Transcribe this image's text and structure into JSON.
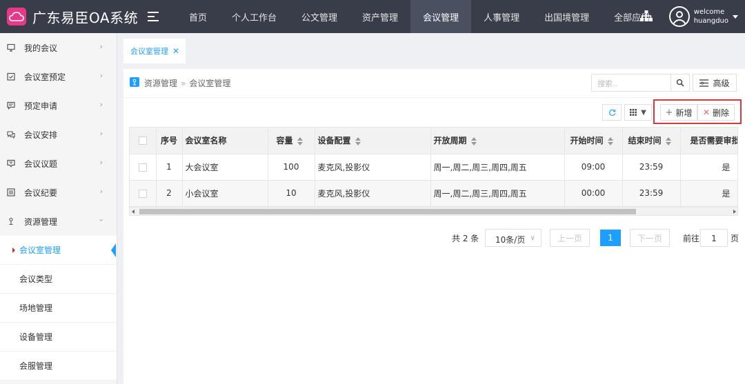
{
  "header": {
    "logo_text": "LOGO",
    "title": "广东易臣OA系统",
    "nav": [
      {
        "label": "首页"
      },
      {
        "label": "个人工作台"
      },
      {
        "label": "公文管理"
      },
      {
        "label": "资产管理"
      },
      {
        "label": "会议管理",
        "active": true
      },
      {
        "label": "人事管理"
      },
      {
        "label": "出国境管理"
      },
      {
        "label": "全部应用"
      }
    ],
    "user": {
      "greeting": "welcome",
      "name": "huangduo"
    }
  },
  "sidebar": {
    "items": [
      {
        "label": "我的会议",
        "icon": "monitor-icon"
      },
      {
        "label": "会议室预定",
        "icon": "calendar-check-icon"
      },
      {
        "label": "预定申请",
        "icon": "message-icon"
      },
      {
        "label": "会议安排",
        "icon": "chat-icon"
      },
      {
        "label": "会议议题",
        "icon": "topic-icon"
      },
      {
        "label": "会议纪要",
        "icon": "list-icon"
      },
      {
        "label": "资源管理",
        "icon": "pin-icon",
        "expanded": true
      }
    ],
    "subitems": [
      {
        "label": "会议室管理",
        "active": true
      },
      {
        "label": "会议类型"
      },
      {
        "label": "场地管理"
      },
      {
        "label": "设备管理"
      },
      {
        "label": "会服管理"
      }
    ]
  },
  "tabs": [
    {
      "label": "会议室管理",
      "close": "✕"
    }
  ],
  "breadcrumb": {
    "parent": "资源管理",
    "separator": "»",
    "current": "会议室管理"
  },
  "search": {
    "placeholder": "搜索..",
    "advanced_label": "高级"
  },
  "toolbar": {
    "add_label": "新增",
    "delete_label": "删除"
  },
  "table": {
    "columns": [
      "序号",
      "会议室名称",
      "容量",
      "设备配置",
      "开放周期",
      "开始时间",
      "结束时间",
      "是否需要审批"
    ],
    "rows": [
      {
        "no": "1",
        "name": "大会议室",
        "capacity": "100",
        "equipment": "麦克风,投影仪",
        "period": "周一,周二,周三,周四,周五",
        "start": "09:00",
        "end": "23:59",
        "approval": "是"
      },
      {
        "no": "2",
        "name": "小会议室",
        "capacity": "10",
        "equipment": "麦克风,投影仪",
        "period": "周一,周二,周三,周四,周五",
        "start": "00:00",
        "end": "23:59",
        "approval": "是"
      }
    ]
  },
  "pagination": {
    "total_text": "共 2 条",
    "page_size": "10条/页",
    "prev_label": "上一页",
    "current_page": "1",
    "next_label": "下一页",
    "goto_label": "前往",
    "goto_value": "1",
    "page_unit": "页"
  },
  "colors": {
    "topbar": "#393d49",
    "accent": "#1e9fff",
    "highlight_box": "#d9363e",
    "logo": "#e8388a"
  }
}
